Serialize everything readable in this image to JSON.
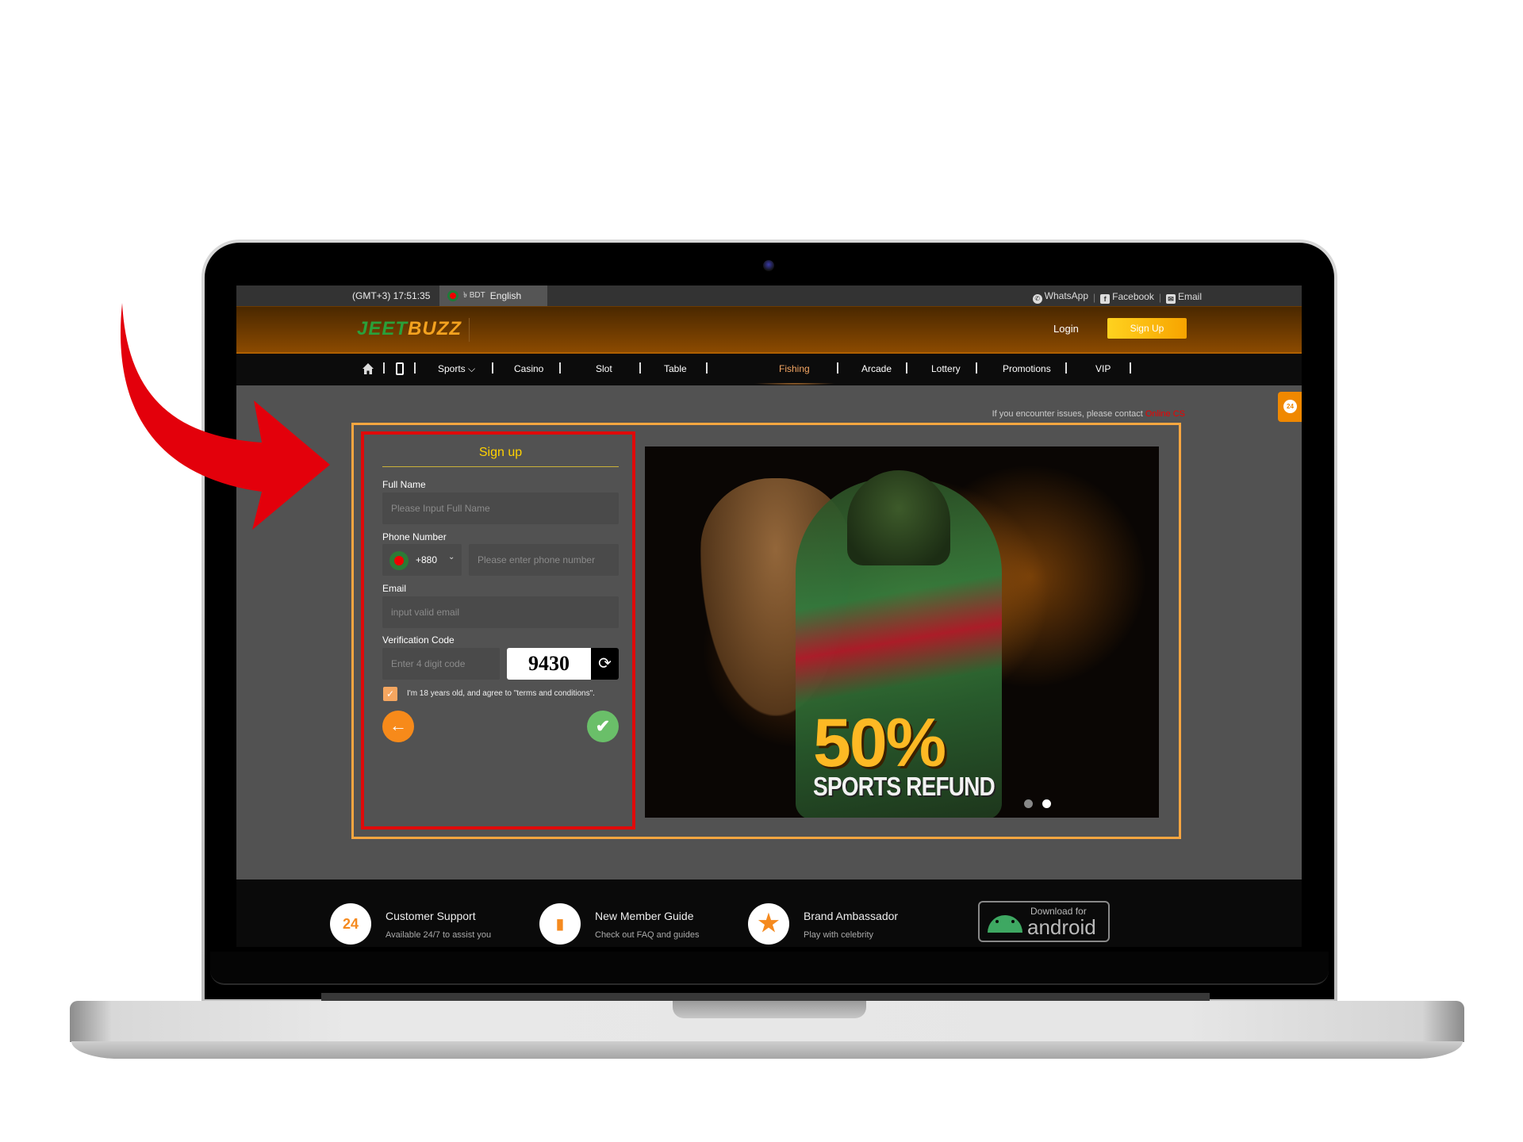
{
  "topbar": {
    "time": "(GMT+3) 17:51:35",
    "currency": "৳ BDT",
    "language": "English",
    "social": [
      {
        "icon": "whatsapp-icon",
        "label": "WhatsApp"
      },
      {
        "icon": "facebook-icon",
        "label": "Facebook"
      },
      {
        "icon": "email-icon",
        "label": "Email"
      }
    ]
  },
  "header": {
    "logo_part1": "JEET",
    "logo_part2": "BUZZ",
    "login_label": "Login",
    "signup_label": "Sign Up"
  },
  "nav": {
    "items": [
      "Sports",
      "Casino",
      "Slot",
      "Table",
      "Fishing",
      "Arcade",
      "Lottery",
      "Promotions",
      "VIP"
    ],
    "active": "Fishing",
    "sports_chevron": "⌵"
  },
  "notice": {
    "text": "If you encounter issues, please contact ",
    "link": "Online CS"
  },
  "signup_form": {
    "title": "Sign up",
    "full_name_label": "Full Name",
    "full_name_placeholder": "Please Input Full Name",
    "phone_label": "Phone Number",
    "country_code": "+880",
    "phone_placeholder": "Please enter phone number",
    "email_label": "Email",
    "email_placeholder": "input valid email",
    "verification_label": "Verification Code",
    "verification_placeholder": "Enter 4 digit code",
    "captcha_code": "9430",
    "agree_text": "I'm 18 years old, and agree to \"terms and conditions\".",
    "agree_checked": true
  },
  "banner": {
    "headline": "50%",
    "subheadline": "SPORTS REFUND",
    "slide_count": 2,
    "active_slide": 2
  },
  "footer": {
    "items": [
      {
        "icon": "24-support-icon",
        "glyph": "24",
        "title": "Customer Support",
        "subtitle": "Available 24/7 to assist you"
      },
      {
        "icon": "book-icon",
        "glyph": "▮",
        "title": "New Member Guide",
        "subtitle": "Check out FAQ and guides"
      },
      {
        "icon": "star-icon",
        "glyph": "★",
        "title": "Brand Ambassador",
        "subtitle": "Play with celebrity"
      }
    ],
    "android_line1": "Download for",
    "android_line2": "android"
  },
  "colors": {
    "accent_orange": "#f8a640",
    "highlight_red": "#e00a0a",
    "title_yellow": "#ffd200",
    "confirm_green": "#6abf69"
  }
}
